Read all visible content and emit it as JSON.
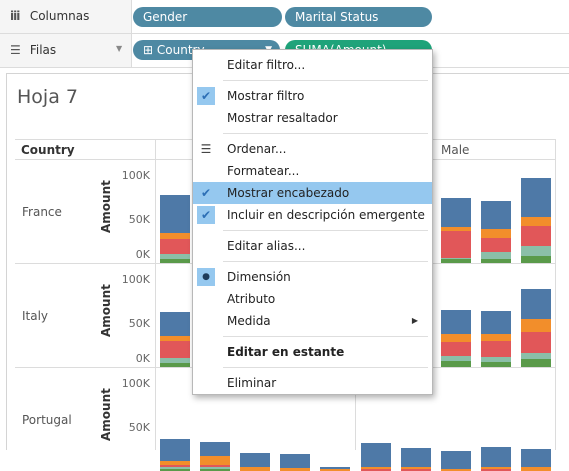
{
  "shelves": {
    "columns": {
      "icon": "columns-shelf-icon",
      "label": "Columnas",
      "pills": [
        {
          "label": "Gender",
          "color": "#4e89a3"
        },
        {
          "label": "Marital Status",
          "color": "#4e89a3"
        }
      ]
    },
    "rows": {
      "icon": "rows-shelf-icon",
      "label": "Filas",
      "dropdown_icon": "chevron-down-icon",
      "pills": [
        {
          "label": "Country",
          "prefix": "⊞",
          "color": "#4e89a3"
        },
        {
          "label": "SUMA(Amount)",
          "color": "#1fa37a"
        }
      ]
    }
  },
  "sheet": {
    "title": "Hoja 7",
    "row_header": "Country",
    "column_header": "Male",
    "axis_label": "Amount",
    "countries": [
      "France",
      "Italy",
      "Portugal"
    ]
  },
  "chart_data": {
    "type": "bar",
    "stacked": true,
    "ylabel": "Amount",
    "ylim": [
      0,
      100000
    ],
    "yticks": [
      "100K",
      "50K",
      "0K"
    ],
    "row_dimension": "Country",
    "rows": [
      "France",
      "Italy",
      "Portugal"
    ],
    "column_header": "Male",
    "segment_colors": [
      "#5a9a4a",
      "#8bbfa8",
      "#e15759",
      "#f28e2b",
      "#4e79a7"
    ],
    "visible_bars": {
      "France": {
        "left": [
          {
            "values": [
              4000,
              6000,
              17000,
              7000,
              43000
            ]
          }
        ],
        "right": [
          {
            "values": [
              4000,
              2000,
              30000,
              5000,
              33000
            ]
          },
          {
            "values": [
              4000,
              9000,
              15000,
              11000,
              32000
            ]
          },
          {
            "values": [
              8000,
              11000,
              23000,
              10000,
              45000
            ]
          }
        ]
      },
      "Italy": {
        "left": [
          {
            "values": [
              5000,
              5000,
              20000,
              5000,
              27000
            ]
          }
        ],
        "right": [
          {
            "values": [
              7000,
              5000,
              16000,
              10000,
              27000
            ]
          },
          {
            "values": [
              6000,
              5000,
              18000,
              9000,
              26000
            ]
          },
          {
            "values": [
              9000,
              7000,
              24000,
              15000,
              34000
            ]
          }
        ]
      },
      "Portugal": {
        "left": [
          {
            "values": [
              2000,
              2000,
              3000,
              4000,
              25000
            ]
          },
          {
            "values": [
              2000,
              2000,
              3000,
              10000,
              16000
            ]
          },
          {
            "values": [
              0,
              0,
              0,
              4000,
              17000
            ]
          },
          {
            "values": [
              0,
              0,
              0,
              3000,
              16000
            ]
          },
          {
            "values": [
              0,
              0,
              0,
              2000,
              2000
            ]
          }
        ],
        "right": [
          {
            "values": [
              0,
              0,
              2000,
              3000,
              27000
            ]
          },
          {
            "values": [
              0,
              0,
              2000,
              2000,
              22000
            ]
          },
          {
            "values": [
              0,
              0,
              0,
              2000,
              21000
            ]
          },
          {
            "values": [
              0,
              0,
              2000,
              3000,
              22000
            ]
          },
          {
            "values": [
              0,
              0,
              0,
              5000,
              20000
            ]
          }
        ]
      }
    }
  },
  "context_menu": {
    "items": [
      {
        "label": "Editar filtro...",
        "checked": false
      },
      {
        "label": "Mostrar filtro",
        "checked": true
      },
      {
        "label": "Mostrar resaltador",
        "checked": false
      },
      {
        "label": "Ordenar...",
        "icon": "sort-icon"
      },
      {
        "label": "Formatear..."
      },
      {
        "label": "Mostrar encabezado",
        "checked": true,
        "highlighted": true
      },
      {
        "label": "Incluir en descripción emergente",
        "checked": true
      },
      {
        "label": "Editar alias..."
      },
      {
        "label": "Dimensión",
        "selected": true
      },
      {
        "label": "Atributo"
      },
      {
        "label": "Medida",
        "submenu": true
      },
      {
        "label": "Editar en estante",
        "bold": true
      },
      {
        "label": "Eliminar"
      }
    ],
    "check_glyph": "✔",
    "bullet_glyph": "●",
    "sort_glyph": "☰",
    "submenu_glyph": "▶"
  }
}
